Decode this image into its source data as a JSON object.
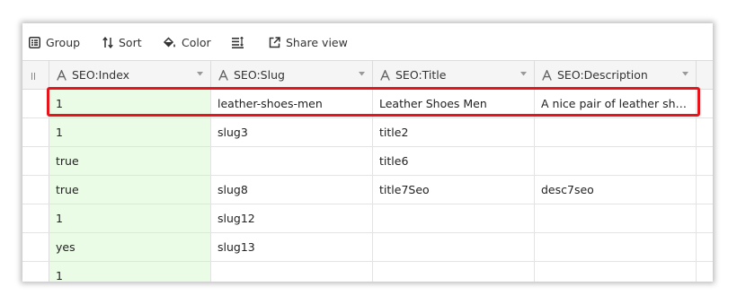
{
  "toolbar": {
    "group_label": "Group",
    "sort_label": "Sort",
    "color_label": "Color",
    "share_label": "Share view"
  },
  "columns": [
    {
      "label": "SEO:Index",
      "icon": "text-type-icon"
    },
    {
      "label": "SEO:Slug",
      "icon": "text-type-icon"
    },
    {
      "label": "SEO:Title",
      "icon": "text-type-icon"
    },
    {
      "label": "SEO:Description",
      "icon": "text-type-icon"
    }
  ],
  "rows": [
    {
      "index": "1",
      "slug": "leather-shoes-men",
      "title": "Leather Shoes Men",
      "description": "A nice pair of leather shoe…"
    },
    {
      "index": "1",
      "slug": "slug3",
      "title": "title2",
      "description": ""
    },
    {
      "index": "true",
      "slug": "",
      "title": "title6",
      "description": ""
    },
    {
      "index": "true",
      "slug": "slug8",
      "title": "title7Seo",
      "description": "desc7seo"
    },
    {
      "index": "1",
      "slug": "slug12",
      "title": "",
      "description": ""
    },
    {
      "index": "yes",
      "slug": "slug13",
      "title": "",
      "description": ""
    },
    {
      "index": "1",
      "slug": "",
      "title": "",
      "description": ""
    }
  ],
  "colors": {
    "highlight": "#e8141c",
    "index_column_bg": "#eafbe6",
    "header_bg": "#f5f5f5"
  }
}
